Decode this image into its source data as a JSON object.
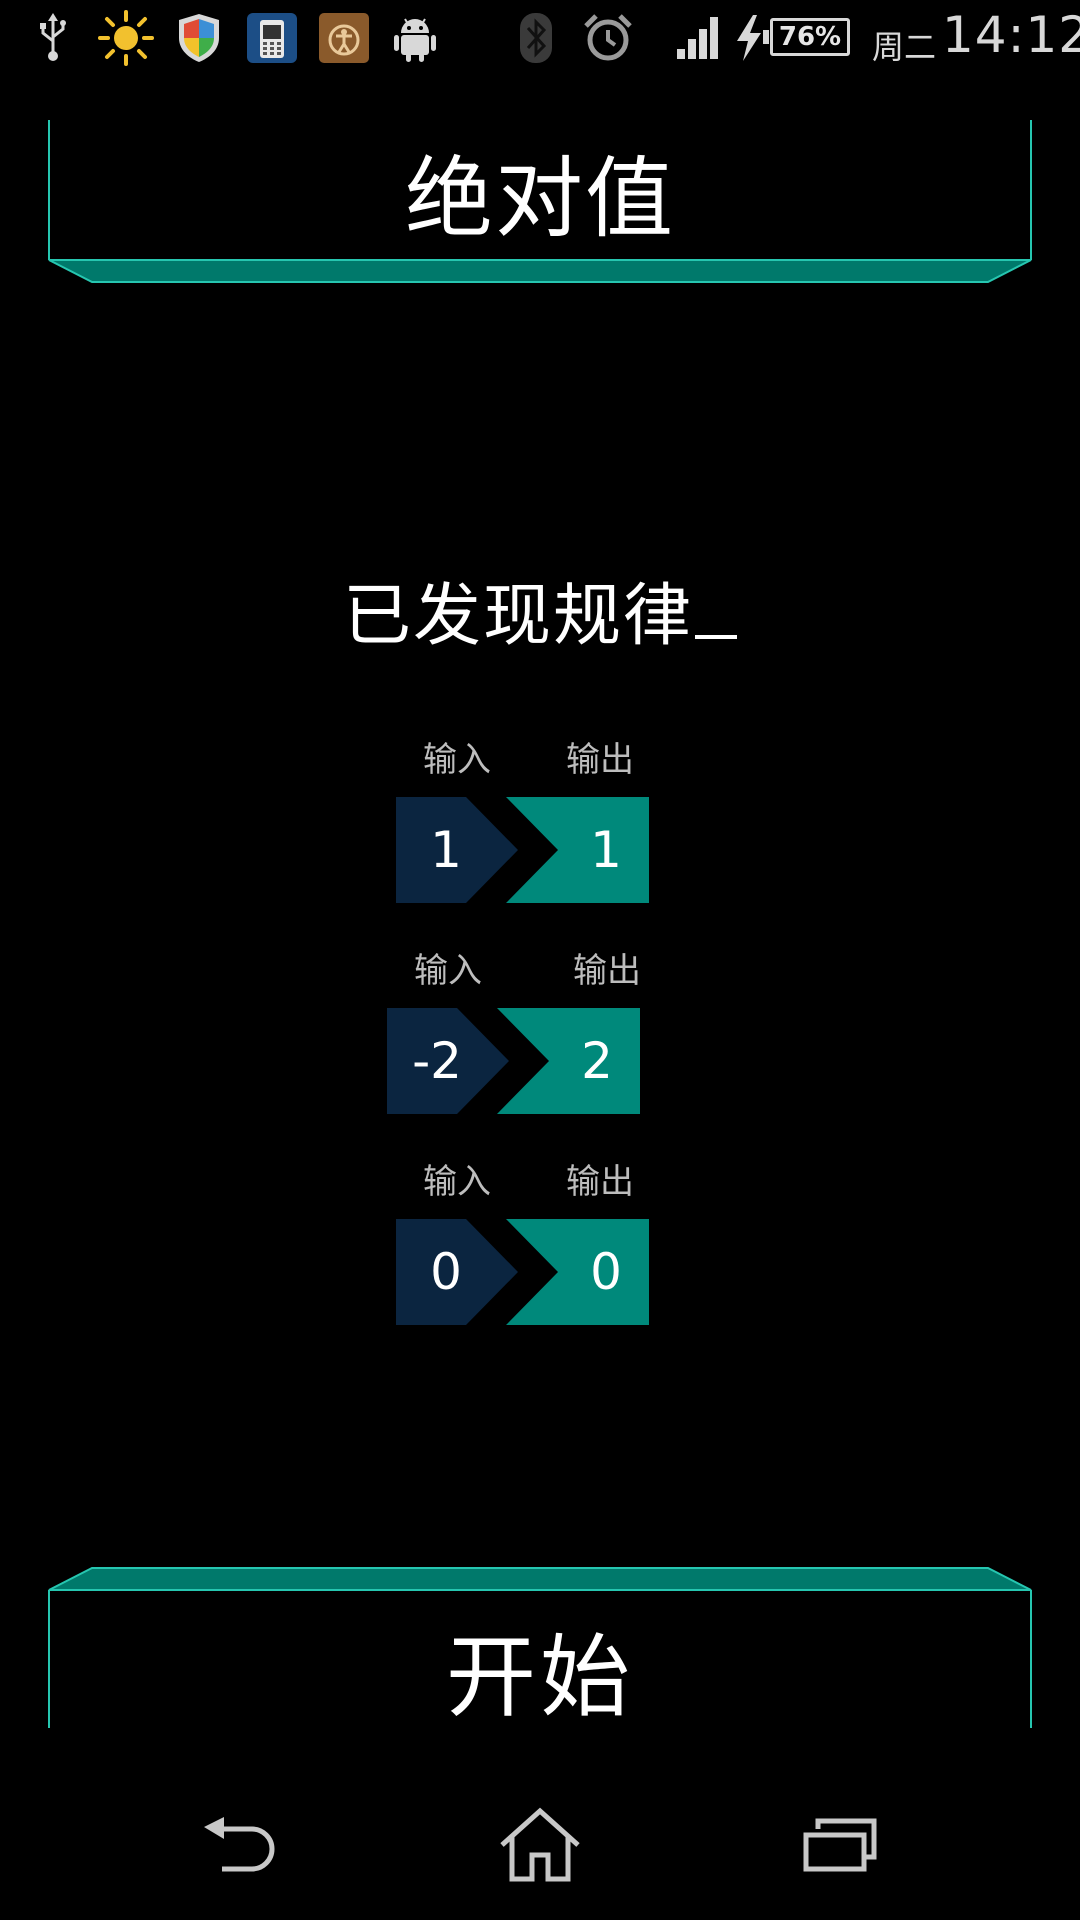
{
  "statusbar": {
    "battery": "76%",
    "day": "周二",
    "time": "14:12"
  },
  "header": {
    "title": "绝对值"
  },
  "main": {
    "found_text": "已发现规律",
    "pairs": [
      {
        "input_label": "输入",
        "output_label": "输出",
        "input": "1",
        "output": "1"
      },
      {
        "input_label": "输入",
        "output_label": "输出",
        "input": "-2",
        "output": "2"
      },
      {
        "input_label": "输入",
        "output_label": "输出",
        "input": "0",
        "output": "0"
      }
    ]
  },
  "footer": {
    "start_label": "开始"
  },
  "colors": {
    "accent": "#26c6b0",
    "input_box": "#0b2540",
    "output_box": "#00897b"
  },
  "icons": {
    "statusbar": [
      "usb-icon",
      "sun-icon",
      "shield-icon",
      "sim-app-icon",
      "accessibility-app-icon",
      "android-icon",
      "bluetooth-icon",
      "alarm-icon",
      "signal-icon",
      "charging-icon"
    ],
    "navbar": [
      "back-icon",
      "home-icon",
      "recents-icon"
    ]
  }
}
